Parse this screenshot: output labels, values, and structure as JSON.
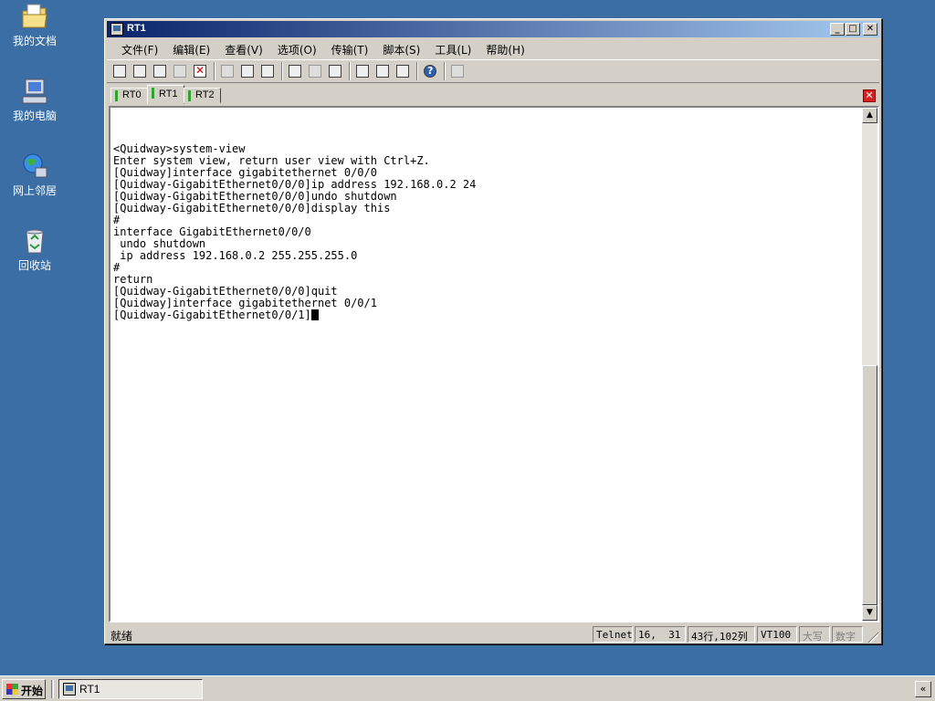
{
  "desktop": {
    "icons": [
      {
        "label": "我的文档",
        "icon": "my-documents-folder-icon"
      },
      {
        "label": "我的电脑",
        "icon": "my-computer-icon"
      },
      {
        "label": "网上邻居",
        "icon": "network-places-icon"
      },
      {
        "label": "回收站",
        "icon": "recycle-bin-icon"
      }
    ]
  },
  "window": {
    "title": "RT1",
    "controls": {
      "minimize": "_",
      "maximize": "□",
      "close": "✕"
    },
    "menu": [
      "文件(F)",
      "编辑(E)",
      "查看(V)",
      "选项(O)",
      "传输(T)",
      "脚本(S)",
      "工具(L)",
      "帮助(H)"
    ],
    "toolbar_icons": [
      "connect-icon",
      "quick-connect-icon",
      "connect-in-tab-icon",
      "reconnect-icon",
      "disconnect-icon",
      "copy-icon",
      "paste-icon",
      "find-icon",
      "print-icon",
      "print-setup-icon",
      "print-screen-icon",
      "session-options-icon",
      "global-options-icon",
      "keymap-icon",
      "help-icon",
      "sftp-icon",
      "toolbar-more-icon"
    ],
    "tabs": [
      {
        "label": "RT0",
        "active": false
      },
      {
        "label": "RT1",
        "active": true
      },
      {
        "label": "RT2",
        "active": false
      }
    ],
    "terminal_lines": [
      "<Quidway>system-view",
      "Enter system view, return user view with Ctrl+Z.",
      "[Quidway]interface gigabitethernet 0/0/0",
      "[Quidway-GigabitEthernet0/0/0]ip address 192.168.0.2 24",
      "[Quidway-GigabitEthernet0/0/0]undo shutdown",
      "[Quidway-GigabitEthernet0/0/0]display this",
      "#",
      "interface GigabitEthernet0/0/0",
      " undo shutdown",
      " ip address 192.168.0.2 255.255.255.0",
      "#",
      "return",
      "[Quidway-GigabitEthernet0/0/0]quit",
      "[Quidway]interface gigabitethernet 0/0/1"
    ],
    "prompt_line": "[Quidway-GigabitEthernet0/0/1]",
    "status": {
      "ready": "就绪",
      "protocol": "Telnet",
      "cursor_pos": "16,  31",
      "size": "43行,102列",
      "terminal_type": "VT100",
      "caps": "大写",
      "num": "数字"
    }
  },
  "taskbar": {
    "start_label": "开始",
    "task_label": "RT1",
    "tray_label": "«"
  }
}
